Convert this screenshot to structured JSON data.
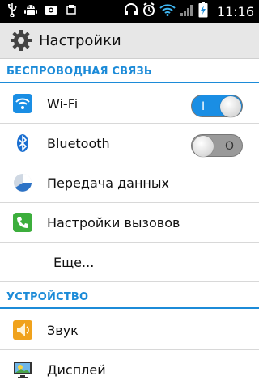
{
  "statusbar": {
    "time": "11:16",
    "left_icons": [
      "usb-icon",
      "android-debug-icon",
      "screenshot-icon",
      "sync-icon"
    ],
    "right_icons": [
      "headset-icon",
      "alarm-icon",
      "wifi-icon",
      "signal-icon",
      "battery-charging-icon"
    ]
  },
  "actionbar": {
    "title": "Настройки",
    "icon": "settings-gear-icon"
  },
  "sections": {
    "wireless": "БЕСПРОВОДНАЯ СВЯЗЬ",
    "device": "УСТРОЙСТВО"
  },
  "rows": {
    "wifi": {
      "label": "Wi-Fi",
      "switch_on": true,
      "switch_mark": "I"
    },
    "bluetooth": {
      "label": "Bluetooth",
      "switch_on": false,
      "switch_mark": "O"
    },
    "data": {
      "label": "Передача данных"
    },
    "calls": {
      "label": "Настройки вызовов"
    },
    "more": {
      "label": "Еще..."
    },
    "sound": {
      "label": "Звук"
    },
    "display": {
      "label": "Дисплей"
    }
  },
  "colors": {
    "accent": "#1c8bd8",
    "switch_on": "#1a8ee4",
    "statusbar": "#000000"
  }
}
